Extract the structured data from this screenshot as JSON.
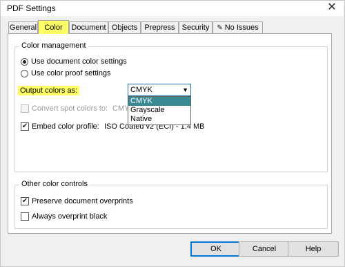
{
  "window": {
    "title": "PDF Settings"
  },
  "tabs": [
    {
      "label": "General"
    },
    {
      "label": "Color"
    },
    {
      "label": "Document"
    },
    {
      "label": "Objects"
    },
    {
      "label": "Prepress"
    },
    {
      "label": "Security"
    },
    {
      "label": "No Issues",
      "icon": "no-issues-icon"
    }
  ],
  "active_tab": "Color",
  "color_management": {
    "group_label": "Color management",
    "radio_document": "Use document color settings",
    "radio_proof": "Use color proof settings",
    "selected_radio": "document",
    "output_label": "Output colors as:",
    "output_value": "CMYK",
    "dropdown_options": [
      "CMYK",
      "Grayscale",
      "Native"
    ],
    "convert_spot_label": "Convert spot colors to:",
    "convert_spot_value": "CMY",
    "embed_profile_label": "Embed color profile:",
    "embed_profile_checked": true,
    "embed_profile_value": "ISO Coated v2 (ECI) - 1.4 MB"
  },
  "other_color_controls": {
    "group_label": "Other color controls",
    "preserve_label": "Preserve document overprints",
    "preserve_checked": true,
    "always_label": "Always overprint black",
    "always_checked": false
  },
  "buttons": {
    "ok": "OK",
    "cancel": "Cancel",
    "help": "Help"
  },
  "colors": {
    "highlight": "#ffff66",
    "selected_option": "#3a8a96",
    "focus_border": "#0078d7"
  }
}
